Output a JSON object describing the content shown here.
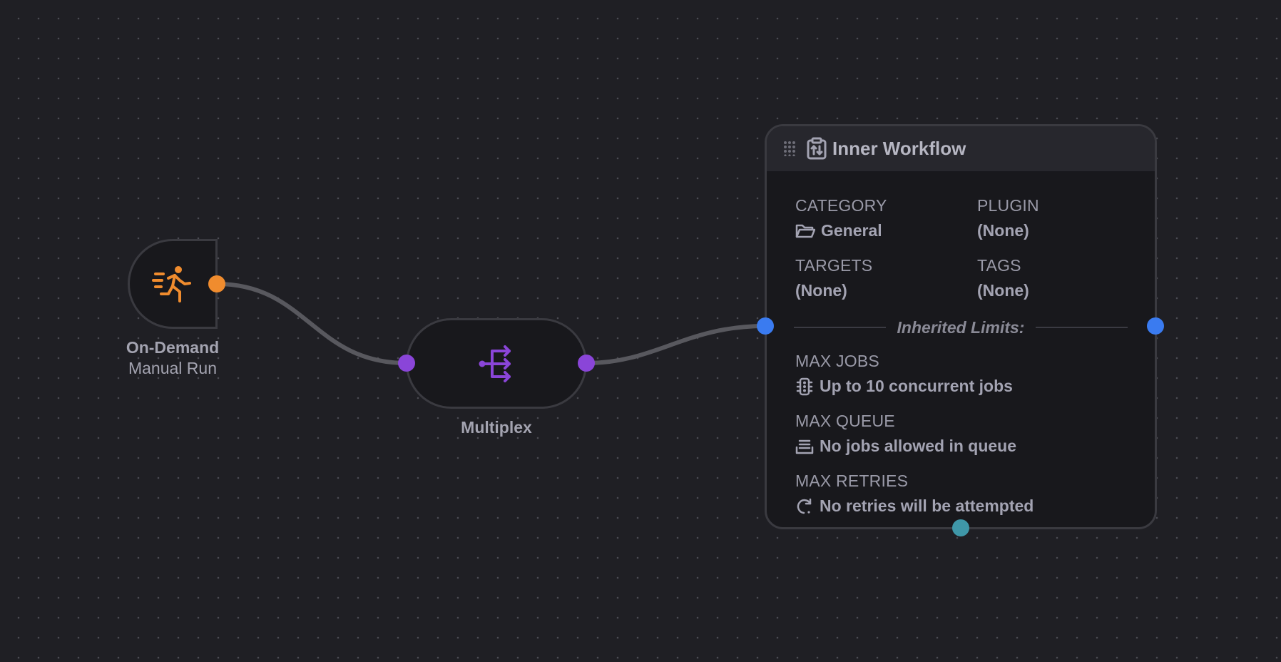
{
  "colors": {
    "canvas_bg": "#1f1f24",
    "trigger_accent": "#f08c2e",
    "multiplex_accent": "#8a45d8",
    "workflow_port": "#3a7bf0",
    "workflow_bottom_port": "#3f97a8",
    "edge": "#58585e"
  },
  "trigger": {
    "icon": "running-person-icon",
    "title": "On-Demand",
    "subtitle": "Manual Run"
  },
  "multiplex": {
    "icon": "multiplex-split-icon",
    "title": "Multiplex"
  },
  "workflow": {
    "icon": "clipboard-icon",
    "title": "Inner Workflow",
    "fields": {
      "category": {
        "label": "CATEGORY",
        "value": "General",
        "icon": "folder-icon"
      },
      "plugin": {
        "label": "PLUGIN",
        "value": "(None)"
      },
      "targets": {
        "label": "TARGETS",
        "value": "(None)"
      },
      "tags": {
        "label": "TAGS",
        "value": "(None)"
      }
    },
    "inherited_label": "Inherited Limits:",
    "limits": {
      "max_jobs": {
        "label": "MAX JOBS",
        "value": "Up to 10 concurrent jobs",
        "icon": "traffic-light-icon"
      },
      "max_queue": {
        "label": "MAX QUEUE",
        "value": "No jobs allowed in queue",
        "icon": "queue-stack-icon"
      },
      "max_retries": {
        "label": "MAX RETRIES",
        "value": "No retries will be attempted",
        "icon": "redo-arrow-icon"
      }
    }
  }
}
